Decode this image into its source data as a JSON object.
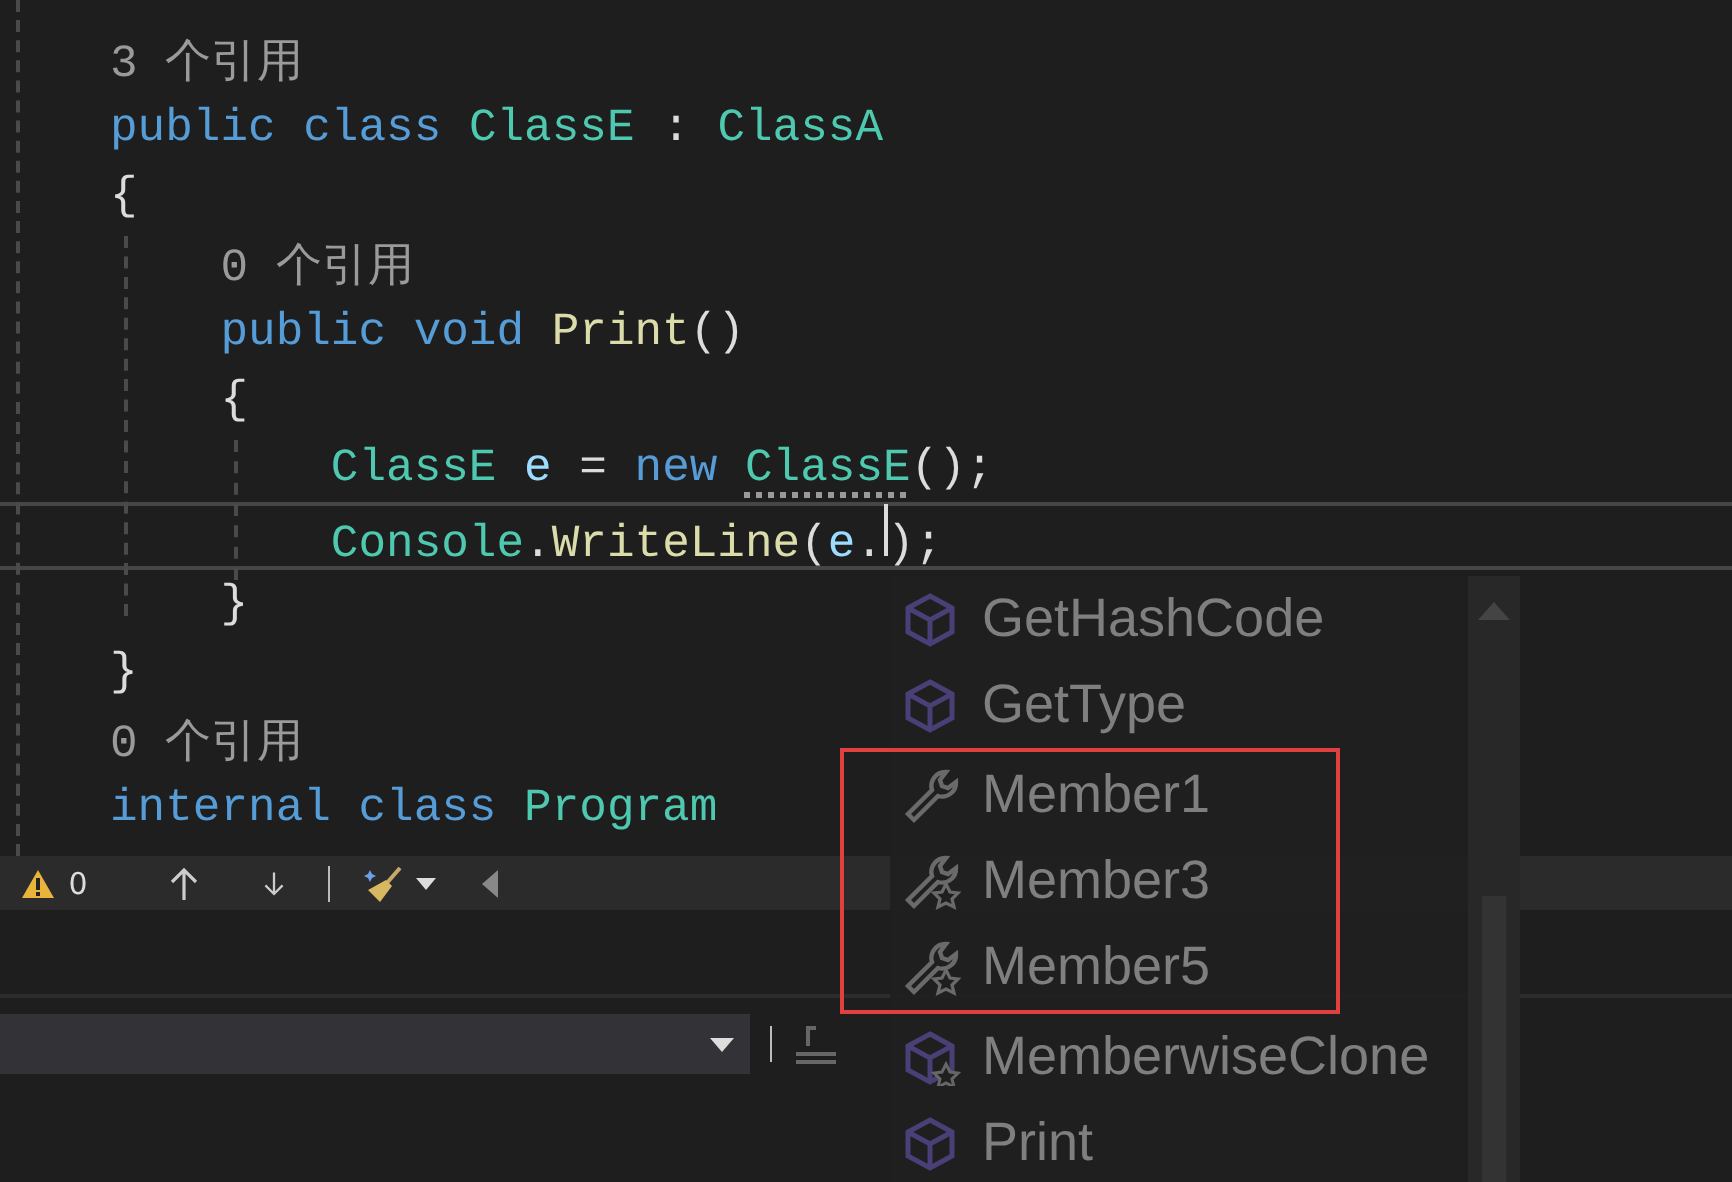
{
  "editor": {
    "lines": [
      {
        "tokens": [
          {
            "kind": "lens",
            "text": "3 个引用"
          }
        ],
        "current": false
      },
      {
        "tokens": [
          {
            "kind": "keyword",
            "text": "public class "
          },
          {
            "kind": "type",
            "text": "ClassE"
          },
          {
            "kind": "plain",
            "text": " : "
          },
          {
            "kind": "type",
            "text": "ClassA"
          }
        ],
        "current": false
      },
      {
        "tokens": [
          {
            "kind": "plain",
            "text": "{"
          }
        ],
        "current": false
      },
      {
        "tokens": [
          {
            "kind": "lens",
            "text": "    0 个引用"
          }
        ],
        "current": false
      },
      {
        "tokens": [
          {
            "kind": "keyword",
            "text": "    public void "
          },
          {
            "kind": "method",
            "text": "Print"
          },
          {
            "kind": "plain",
            "text": "()"
          }
        ],
        "current": false
      },
      {
        "tokens": [
          {
            "kind": "plain",
            "text": "    {"
          }
        ],
        "current": false
      },
      {
        "tokens": [
          {
            "kind": "type",
            "text": "        ClassE "
          },
          {
            "kind": "variable",
            "text": "e"
          },
          {
            "kind": "plain",
            "text": " = "
          },
          {
            "kind": "keyword",
            "text": "new "
          },
          {
            "kind": "type_hint",
            "text": "ClassE"
          },
          {
            "kind": "plain",
            "text": "();"
          }
        ],
        "current": false
      },
      {
        "tokens": [
          {
            "kind": "type",
            "text": "        Console"
          },
          {
            "kind": "plain",
            "text": "."
          },
          {
            "kind": "method",
            "text": "WriteLine"
          },
          {
            "kind": "plain",
            "text": "("
          },
          {
            "kind": "variable",
            "text": "e"
          },
          {
            "kind": "plain",
            "text": "."
          },
          {
            "kind": "caret"
          },
          {
            "kind": "plain",
            "text": ");"
          }
        ],
        "current": true
      },
      {
        "tokens": [
          {
            "kind": "plain",
            "text": "    }"
          }
        ],
        "current": false
      },
      {
        "tokens": [
          {
            "kind": "plain",
            "text": "}"
          }
        ],
        "current": false
      },
      {
        "tokens": [
          {
            "kind": "lens",
            "text": "0 个引用"
          }
        ],
        "current": false
      },
      {
        "tokens": [
          {
            "kind": "keyword",
            "text": "internal class "
          },
          {
            "kind": "type",
            "text": "Program"
          }
        ],
        "current": false
      }
    ]
  },
  "toolbar": {
    "warning_count": "0"
  },
  "completion": {
    "items": [
      {
        "label": "GetHashCode",
        "kind": "method",
        "framed": false
      },
      {
        "label": "GetType",
        "kind": "method",
        "framed": false
      },
      {
        "label": "Member1",
        "kind": "property",
        "framed": true
      },
      {
        "label": "Member3",
        "kind": "property_star",
        "framed": true
      },
      {
        "label": "Member5",
        "kind": "property_star",
        "framed": true
      },
      {
        "label": "MemberwiseClone",
        "kind": "method_star",
        "framed": false
      },
      {
        "label": "Print",
        "kind": "method",
        "framed": false
      }
    ]
  }
}
